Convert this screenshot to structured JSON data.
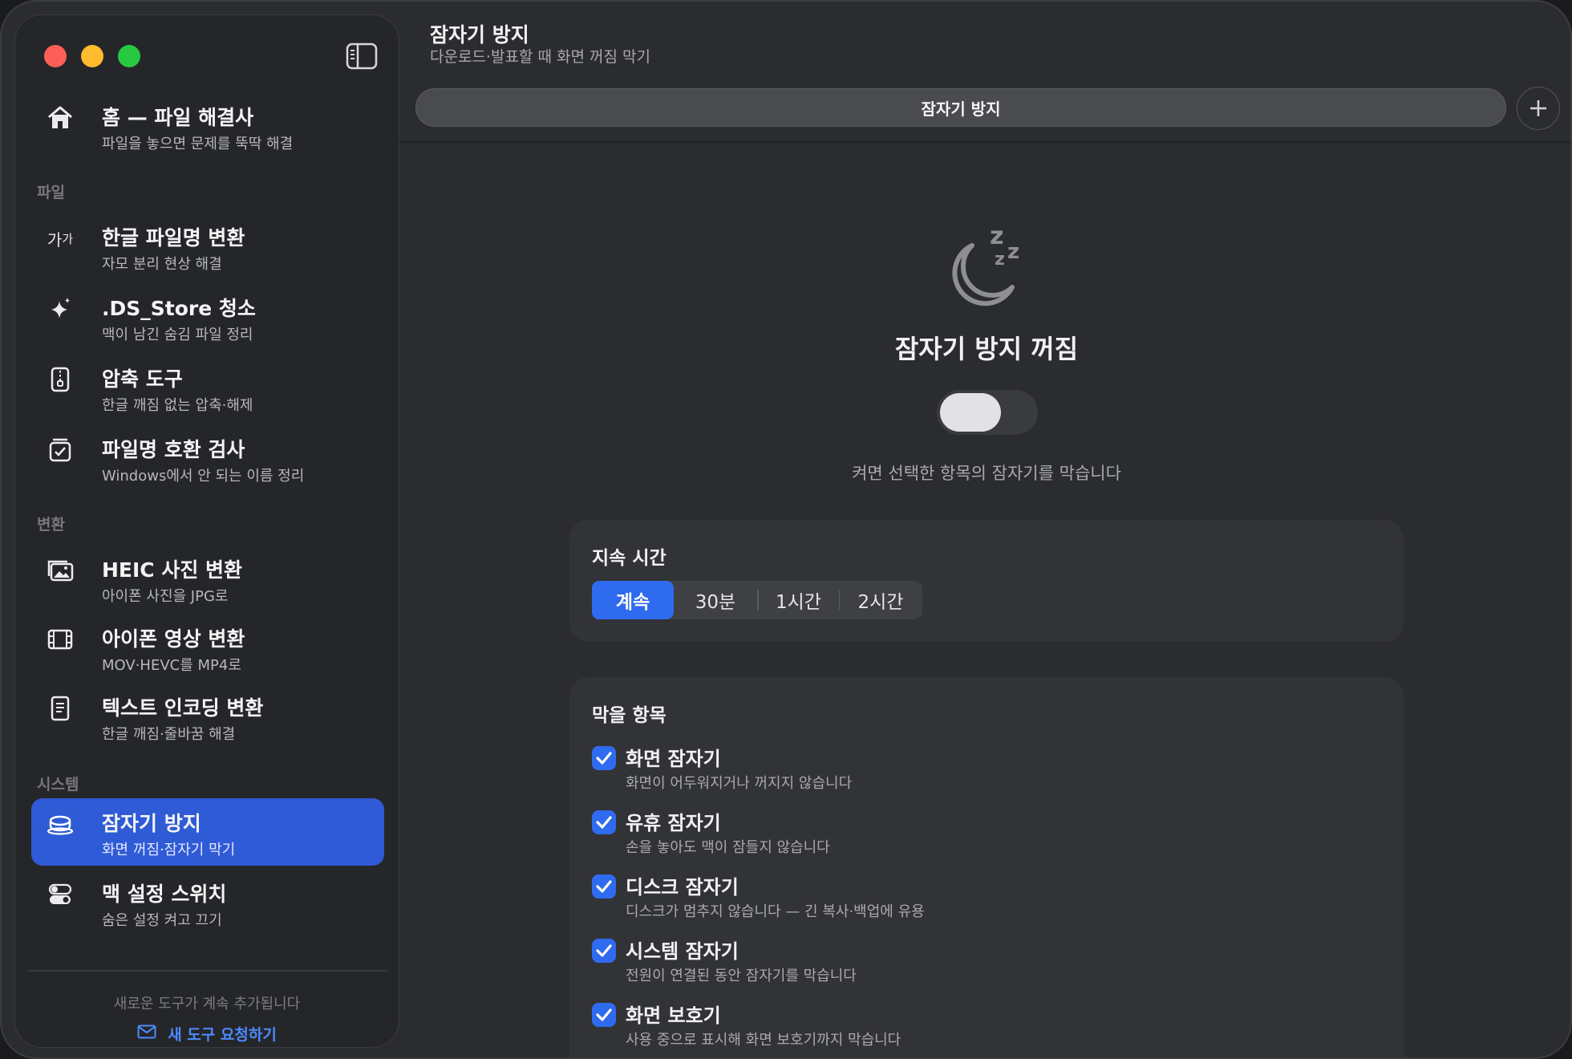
{
  "sidebar": {
    "home": {
      "title": "홈 — 파일 해결사",
      "subtitle": "파일을 놓으면 문제를 뚝딱 해결"
    },
    "sections": {
      "files": "파일",
      "convert": "변환",
      "system": "시스템"
    },
    "items": [
      {
        "title": "한글 파일명 변환",
        "subtitle": "자모 분리 현상 해결",
        "icon": "ga-text-icon"
      },
      {
        "title": ".DS_Store 청소",
        "subtitle": "맥이 남긴 숨김 파일 정리",
        "icon": "sparkle-icon"
      },
      {
        "title": "압축 도구",
        "subtitle": "한글 깨짐 없는 압축·해제",
        "icon": "zip-icon"
      },
      {
        "title": "파일명 호환 검사",
        "subtitle": "Windows에서 안 되는 이름 정리",
        "icon": "checklist-icon"
      },
      {
        "title": "HEIC 사진 변환",
        "subtitle": "아이폰 사진을 JPG로",
        "icon": "photos-icon"
      },
      {
        "title": "아이폰 영상 변환",
        "subtitle": "MOV·HEVC를 MP4로",
        "icon": "film-icon"
      },
      {
        "title": "텍스트 인코딩 변환",
        "subtitle": "한글 깨짐·줄바꿈 해결",
        "icon": "document-icon"
      },
      {
        "title": "잠자기 방지",
        "subtitle": "화면 꺼짐·잠자기 막기",
        "icon": "cup-icon",
        "active": true
      },
      {
        "title": "맥 설정 스위치",
        "subtitle": "숨은 설정 켜고 끄기",
        "icon": "switches-icon"
      }
    ],
    "icon_text_ga": "가가",
    "footer_note": "새로운 도구가 계속 추가됩니다",
    "footer_link": "새 도구 요청하기"
  },
  "header": {
    "title": "잠자기 방지",
    "subtitle": "다운로드·발표할 때 화면 꺼짐 막기",
    "tab_label": "잠자기 방지"
  },
  "hero": {
    "title": "잠자기 방지 꺼짐",
    "toggle_on": false,
    "description": "켜면 선택한 항목의 잠자기를 막습니다"
  },
  "duration": {
    "title": "지속 시간",
    "options": [
      "계속",
      "30분",
      "1시간",
      "2시간"
    ],
    "selected": "계속"
  },
  "prevent": {
    "title": "막을 항목",
    "items": [
      {
        "label": "화면 잠자기",
        "desc": "화면이 어두워지거나 꺼지지 않습니다",
        "checked": true
      },
      {
        "label": "유휴 잠자기",
        "desc": "손을 놓아도 맥이 잠들지 않습니다",
        "checked": true
      },
      {
        "label": "디스크 잠자기",
        "desc": "디스크가 멈추지 않습니다 — 긴 복사·백업에 유용",
        "checked": true
      },
      {
        "label": "시스템 잠자기",
        "desc": "전원이 연결된 동안 잠자기를 막습니다",
        "checked": true
      },
      {
        "label": "화면 보호기",
        "desc": "사용 중으로 표시해 화면 보호기까지 막습니다",
        "checked": true
      }
    ]
  },
  "colors": {
    "accent": "#2f6bef",
    "sidebar_active": "#2f5bd6",
    "link": "#4d8bff"
  }
}
